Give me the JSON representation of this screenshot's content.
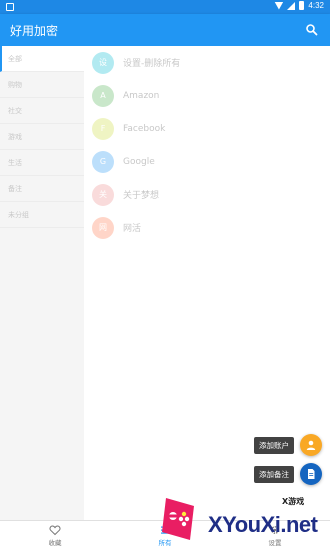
{
  "status_bar": {
    "time": "4:32"
  },
  "app_bar": {
    "title": "好用加密"
  },
  "sidebar": {
    "items": [
      {
        "label": "全部",
        "active": true
      },
      {
        "label": "购物"
      },
      {
        "label": "社交"
      },
      {
        "label": "游戏"
      },
      {
        "label": "生活"
      },
      {
        "label": "备注"
      },
      {
        "label": "未分组"
      }
    ]
  },
  "accounts": [
    {
      "initial": "设",
      "name": "设置-删除所有",
      "color": "#26C6DA"
    },
    {
      "initial": "A",
      "name": "Amazon",
      "color": "#66BB6A"
    },
    {
      "initial": "F",
      "name": "Facebook",
      "color": "#D4E157"
    },
    {
      "initial": "G",
      "name": "Google",
      "color": "#42A5F5"
    },
    {
      "initial": "关",
      "name": "关于梦想",
      "color": "#EF9A9A"
    },
    {
      "initial": "网",
      "name": "网活",
      "color": "#FF8A65"
    }
  ],
  "fab": {
    "add_account": "添加账户",
    "add_note": "添加备注",
    "account_color": "#F9A825",
    "note_color": "#1565C0"
  },
  "bottom_nav": {
    "favorites": "收藏",
    "all": "所有",
    "settings": "设置"
  },
  "watermark": {
    "text": "XYouXi.net",
    "small": "X游戏"
  }
}
